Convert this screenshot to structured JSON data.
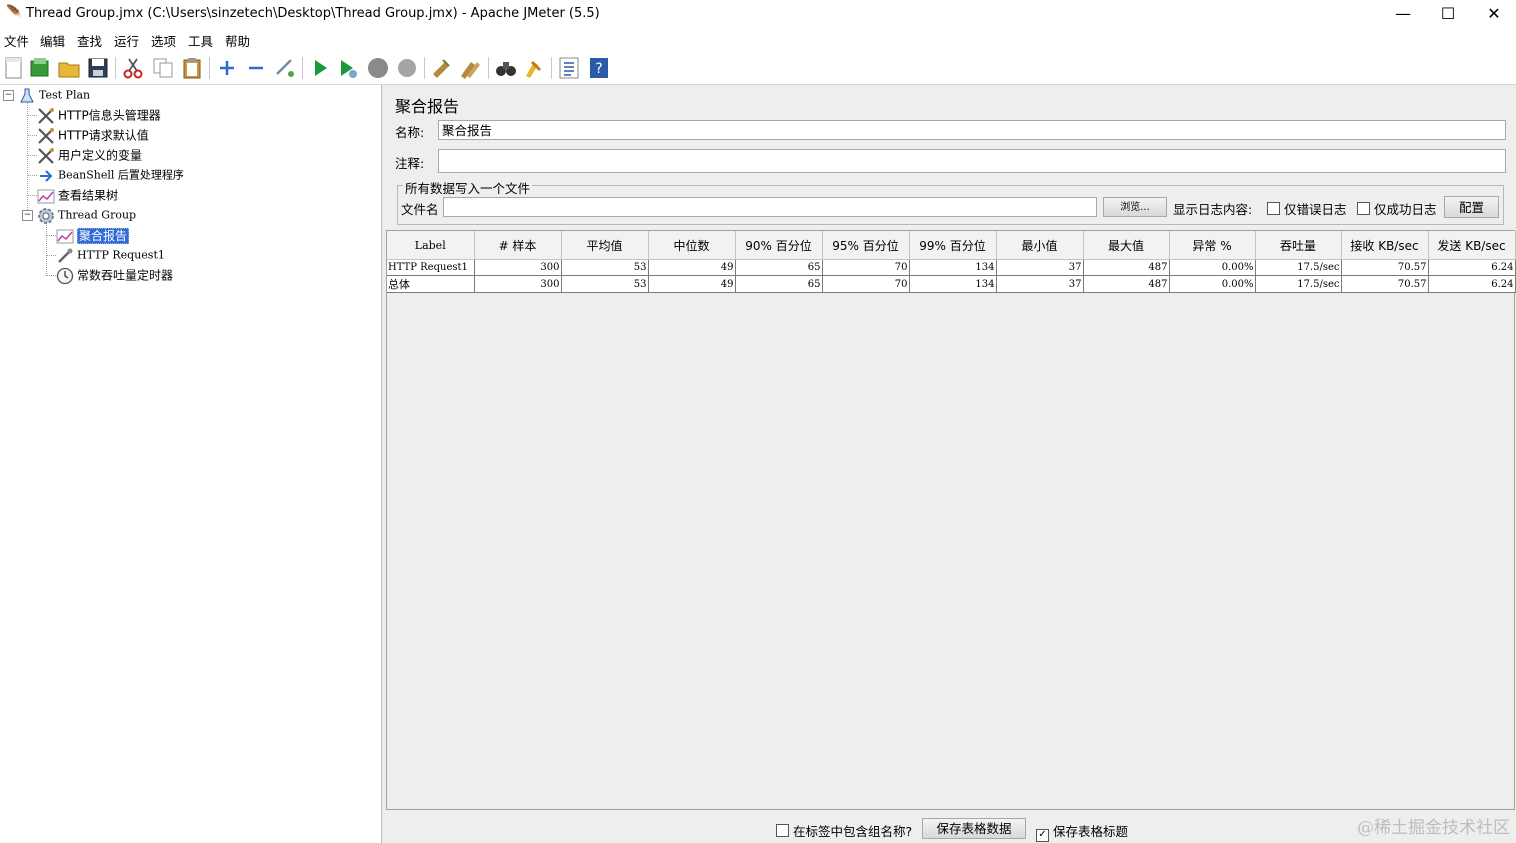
{
  "window": {
    "title": "Thread Group.jmx (C:\\Users\\sinzetech\\Desktop\\Thread Group.jmx) - Apache JMeter (5.5)",
    "minimize": "—",
    "maximize": "☐",
    "close": "✕"
  },
  "menu": [
    "文件",
    "编辑",
    "查找",
    "运行",
    "选项",
    "工具",
    "帮助"
  ],
  "toolbar_icons": [
    "new-icon",
    "templates-icon",
    "open-icon",
    "save-icon",
    "cut-icon",
    "copy-icon",
    "paste-icon",
    "expand-icon",
    "collapse-icon",
    "toggle-icon",
    "start-icon",
    "start-no-pauses-icon",
    "stop-icon",
    "shutdown-icon",
    "clear-icon",
    "clear-all-icon",
    "search-icon",
    "reset-search-icon",
    "function-helper-icon",
    "help-icon"
  ],
  "tree": {
    "test_plan": "Test Plan",
    "http_header_manager": "HTTP信息头管理器",
    "http_request_defaults": "HTTP请求默认值",
    "user_defined_variables": "用户定义的变量",
    "beanshell_postprocessor": "BeanShell 后置处理程序",
    "view_results_tree": "查看结果树",
    "thread_group": "Thread Group",
    "aggregate_report": "聚合报告",
    "http_request1": "HTTP Request1",
    "constant_throughput_timer": "常数吞吐量定时器"
  },
  "panel": {
    "heading": "聚合报告",
    "name_label": "名称:",
    "name_value": "聚合报告",
    "comment_label": "注释:",
    "comment_value": "",
    "group_title": "所有数据写入一个文件",
    "filename_label": "文件名",
    "filename_value": "",
    "browse_button": "浏览...",
    "log_display_label": "显示日志内容:",
    "errors_only": "仅错误日志",
    "success_only": "仅成功日志",
    "configure_button": "配置"
  },
  "table": {
    "headers": [
      "Label",
      "# 样本",
      "平均值",
      "中位数",
      "90% 百分位",
      "95% 百分位",
      "99% 百分位",
      "最小值",
      "最大值",
      "异常 %",
      "吞吐量",
      "接收 KB/sec",
      "发送 KB/sec"
    ],
    "rows": [
      [
        "HTTP Request1",
        "300",
        "53",
        "49",
        "65",
        "70",
        "134",
        "37",
        "487",
        "0.00%",
        "17.5/sec",
        "70.57",
        "6.24"
      ],
      [
        "总体",
        "300",
        "53",
        "49",
        "65",
        "70",
        "134",
        "37",
        "487",
        "0.00%",
        "17.5/sec",
        "70.57",
        "6.24"
      ]
    ]
  },
  "bottom": {
    "include_group_name": "在标签中包含组名称?",
    "save_table_data": "保存表格数据",
    "save_table_header": "保存表格标题",
    "include_group_name_checked": false,
    "save_table_header_checked": true
  },
  "watermark": "@稀土掘金技术社区"
}
